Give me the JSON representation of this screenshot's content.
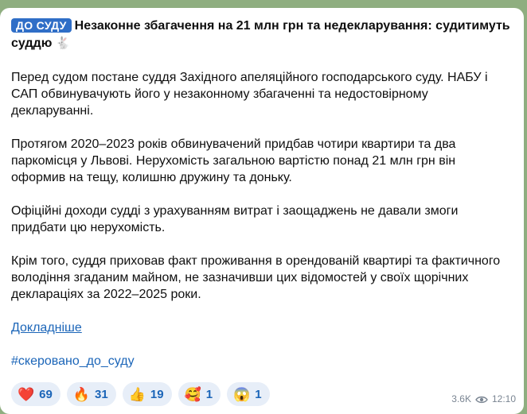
{
  "post": {
    "tag": "ДО СУДУ",
    "title": "Незаконне збагачення на 21 млн грн та недекларування: судитимуть суддю",
    "title_emoji": "🐇",
    "paragraphs": [
      "Перед судом постане суддя Західного апеляційного господарського суду. НАБУ і САП обвинувачують його у незаконному збагаченні та недостовірному декларуванні.",
      "Протягом 2020–2023 років обвинувачений придбав чотири квартири та два паркомісця у Львові. Нерухомість загальною вартістю понад 21 млн грн він оформив на тещу, колишню дружину та доньку.",
      "Офіційні доходи судді з урахуванням витрат і заощаджень не давали змоги придбати цю нерухомість.",
      "Крім того, суддя приховав факт проживання в орендованій квартирі та фактичного володіння згаданим майном, не зазначивши цих відомостей у своїх щорічних деклараціях за 2022–2025 роки."
    ],
    "link_label": "Докладніше",
    "hashtag": "#скеровано_до_суду"
  },
  "reactions": [
    {
      "emoji": "❤️",
      "count": "69",
      "icon": "heart-icon"
    },
    {
      "emoji": "🔥",
      "count": "31",
      "icon": "fire-icon"
    },
    {
      "emoji": "👍",
      "count": "19",
      "icon": "thumbs-up-icon"
    },
    {
      "emoji": "🥰",
      "count": "1",
      "icon": "smiling-face-with-hearts-icon"
    },
    {
      "emoji": "😱",
      "count": "1",
      "icon": "screaming-face-icon"
    }
  ],
  "meta": {
    "views": "3.6K",
    "time": "12:10"
  }
}
